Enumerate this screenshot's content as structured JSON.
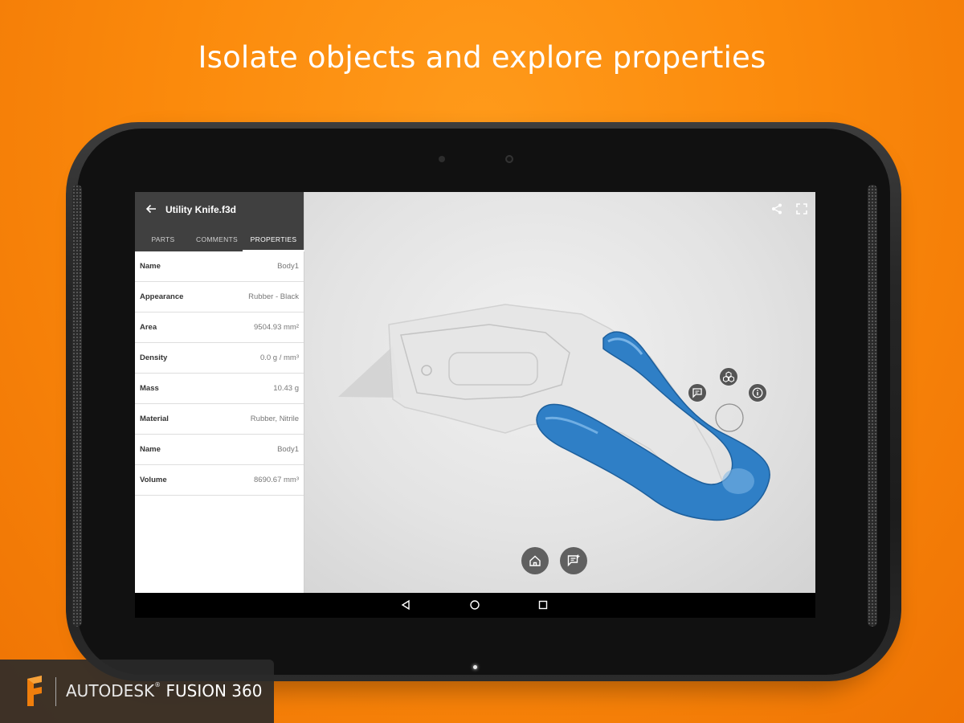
{
  "headline": "Isolate objects and explore properties",
  "app": {
    "file_title": "Utility Knife.f3d",
    "tabs": [
      {
        "label": "PARTS",
        "active": false
      },
      {
        "label": "COMMENTS",
        "active": false
      },
      {
        "label": "PROPERTIES",
        "active": true
      }
    ],
    "properties": [
      {
        "key": "Name",
        "value": "Body1"
      },
      {
        "key": "Appearance",
        "value": "Rubber - Black"
      },
      {
        "key": "Area",
        "value": "9504.93 mm²"
      },
      {
        "key": "Density",
        "value": "0.0 g / mm³"
      },
      {
        "key": "Mass",
        "value": "10.43 g"
      },
      {
        "key": "Material",
        "value": "Rubber, Nitrile"
      },
      {
        "key": "Name",
        "value": "Body1"
      },
      {
        "key": "Volume",
        "value": "8690.67 mm³"
      }
    ]
  },
  "icons": {
    "header": "back-arrow-icon",
    "viewport_top": [
      "share-icon",
      "fullscreen-icon"
    ],
    "viewport_bottom": [
      "home-icon",
      "add-comment-icon"
    ],
    "context_menu": [
      "add-comment-icon",
      "isolate-icon",
      "info-icon"
    ],
    "navbar": [
      "nav-back-icon",
      "nav-home-icon",
      "nav-recent-icon"
    ]
  },
  "colors": {
    "background": "#fb8a0c",
    "header": "#404040",
    "selected_part": "#2f7fc6",
    "fab": "#606060"
  },
  "brand": {
    "company": "AUTODESK",
    "registered": "®",
    "product": "FUSION 360"
  }
}
